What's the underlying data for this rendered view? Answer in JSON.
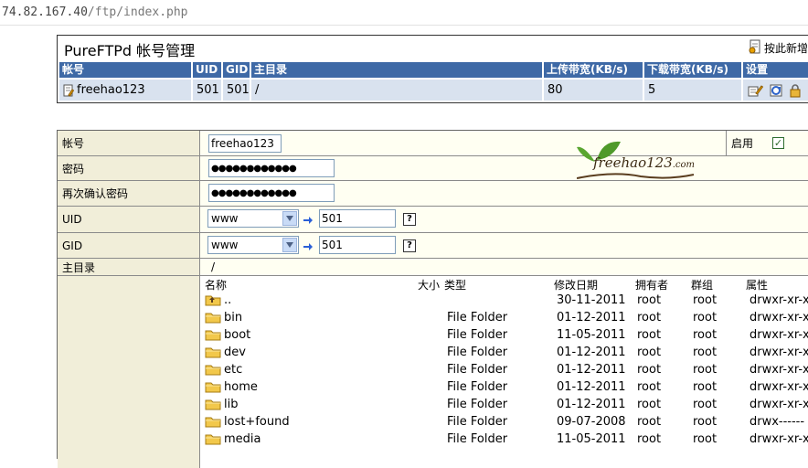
{
  "browser": {
    "url_host": "74.82.167.40",
    "url_path": "/ftp/index.php"
  },
  "accounts_panel": {
    "title": "PureFTPd 帐号管理",
    "add_new_label": "按此新增",
    "columns": [
      "帐号",
      "UID",
      "GID",
      "主目录",
      "上传带宽(KB/s)",
      "下载带宽(KB/s)",
      "设置"
    ],
    "rows": [
      {
        "user": "freehao123",
        "uid": "501",
        "gid": "501",
        "home": "/",
        "upload": "80",
        "download": "5"
      }
    ]
  },
  "form": {
    "account_label": "帐号",
    "account_value": "freehao123",
    "enable_label": "启用",
    "enabled": true,
    "password_label": "密码",
    "password_value": "●●●●●●●●●●●●",
    "confirm_label": "再次确认密码",
    "confirm_value": "●●●●●●●●●●●●",
    "uid_label": "UID",
    "uid_select": "www",
    "uid_value": "501",
    "gid_label": "GID",
    "gid_select": "www",
    "gid_value": "501",
    "home_label": "主目录",
    "home_value": "/",
    "logo_text": "freehao123",
    "logo_suffix": ".com"
  },
  "file_list": {
    "headers": {
      "name": "名称",
      "size": "大小",
      "type": "类型",
      "modified": "修改日期",
      "owner": "拥有者",
      "group": "群组",
      "attr": "属性"
    },
    "items": [
      {
        "name": "..",
        "type": "",
        "date": "30-11-2011",
        "owner": "root",
        "group": "root",
        "attr": "drwxr-xr-x",
        "parent": true
      },
      {
        "name": "bin",
        "type": "File Folder",
        "date": "01-12-2011",
        "owner": "root",
        "group": "root",
        "attr": "drwxr-xr-x"
      },
      {
        "name": "boot",
        "type": "File Folder",
        "date": "11-05-2011",
        "owner": "root",
        "group": "root",
        "attr": "drwxr-xr-x"
      },
      {
        "name": "dev",
        "type": "File Folder",
        "date": "01-12-2011",
        "owner": "root",
        "group": "root",
        "attr": "drwxr-xr-x"
      },
      {
        "name": "etc",
        "type": "File Folder",
        "date": "01-12-2011",
        "owner": "root",
        "group": "root",
        "attr": "drwxr-xr-x"
      },
      {
        "name": "home",
        "type": "File Folder",
        "date": "01-12-2011",
        "owner": "root",
        "group": "root",
        "attr": "drwxr-xr-x"
      },
      {
        "name": "lib",
        "type": "File Folder",
        "date": "01-12-2011",
        "owner": "root",
        "group": "root",
        "attr": "drwxr-xr-x"
      },
      {
        "name": "lost+found",
        "type": "File Folder",
        "date": "09-07-2008",
        "owner": "root",
        "group": "root",
        "attr": "drwx------"
      },
      {
        "name": "media",
        "type": "File Folder",
        "date": "11-05-2011",
        "owner": "root",
        "group": "root",
        "attr": "drwxr-xr-x"
      }
    ]
  },
  "colors": {
    "header_blue": "#3e69a6",
    "row_blue": "#d9e2ef",
    "label_bg": "#f1eed9",
    "folder": "#f2c84b"
  }
}
